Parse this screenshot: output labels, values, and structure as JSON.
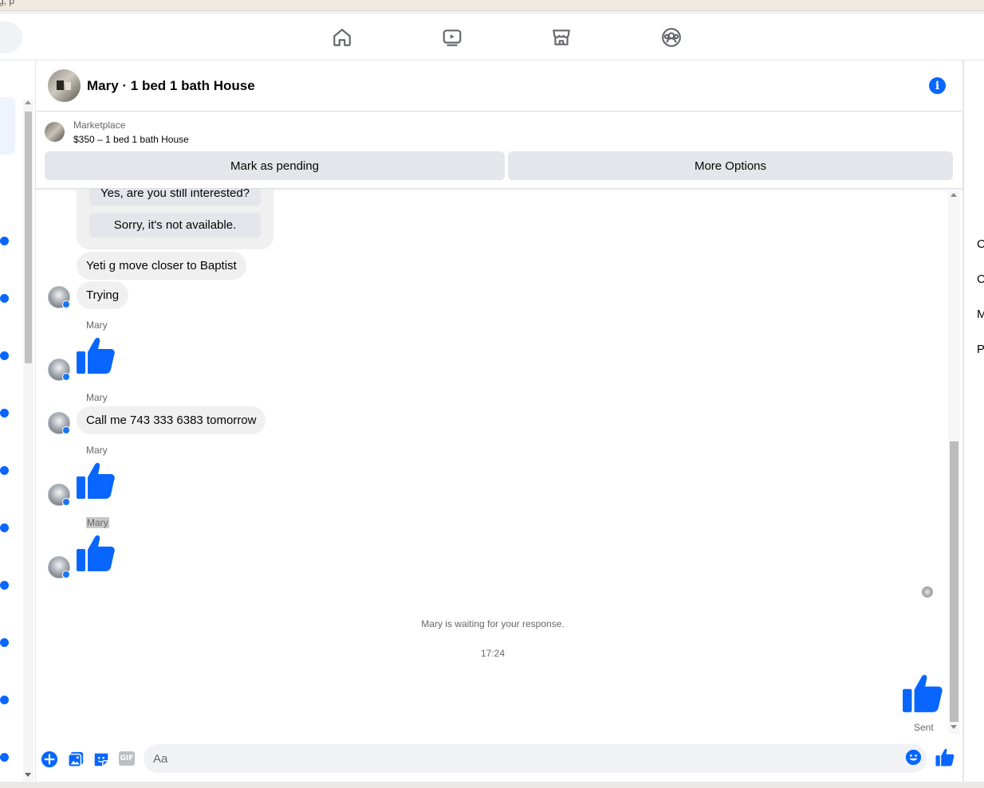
{
  "browser": {
    "url_fragment": "g, p"
  },
  "nav": {
    "icons": [
      "home-icon",
      "video-icon",
      "marketplace-icon",
      "groups-icon"
    ]
  },
  "header": {
    "title": "Mary · 1 bed 1 bath House",
    "info_icon": "info-icon"
  },
  "listing": {
    "source": "Marketplace",
    "price_title": "$350 – 1 bed 1 bath House",
    "buttons": {
      "pending": "Mark as pending",
      "more": "More Options"
    }
  },
  "quick_replies": [
    "Yes, are you still interested?",
    "Sorry, it's not available."
  ],
  "messages": {
    "m1": "Yeti g move closer to Baptist",
    "m2": "Trying",
    "name1": "Mary",
    "name2": "Mary",
    "m3": "Call me 743 333 6383  tomorrow",
    "name3": "Mary",
    "name4": "Mary"
  },
  "status": {
    "waiting": "Mary is waiting for your response.",
    "time": "17:24",
    "sent": "Sent"
  },
  "composer": {
    "placeholder": "Aa",
    "gif_label": "GIF"
  },
  "right_panel": {
    "letters": [
      "C",
      "C",
      "M",
      "P"
    ]
  },
  "colors": {
    "accent": "#0866ff",
    "bubble": "#f0f0f0",
    "button": "#e4e6eb"
  }
}
